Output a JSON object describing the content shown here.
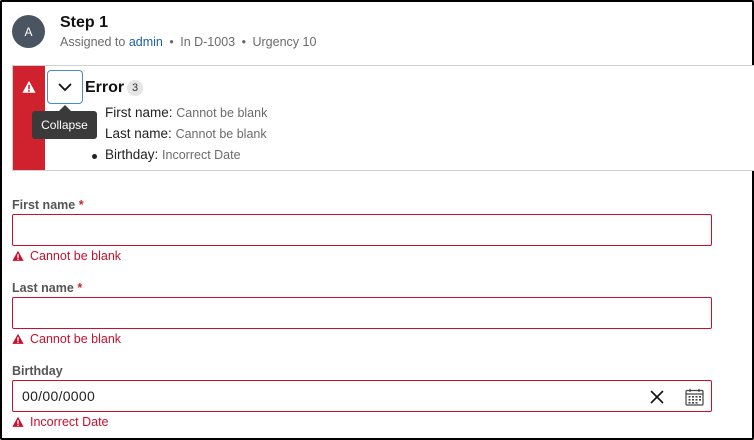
{
  "header": {
    "avatar_initial": "A",
    "title": "Step 1",
    "assigned_prefix": "Assigned to",
    "assignee": "admin",
    "case_id": "In D-1003",
    "urgency": "Urgency 10"
  },
  "error_banner": {
    "title": "Error",
    "count": "3",
    "collapse_tooltip": "Collapse",
    "items": [
      {
        "field": "First name:",
        "message": "Cannot be blank"
      },
      {
        "field": "Last name:",
        "message": "Cannot be blank"
      },
      {
        "field": "Birthday:",
        "message": "Incorrect Date"
      }
    ]
  },
  "form": {
    "first_name": {
      "label": "First name",
      "required_mark": "*",
      "value": "",
      "error": "Cannot be blank"
    },
    "last_name": {
      "label": "Last name",
      "required_mark": "*",
      "value": "",
      "error": "Cannot be blank"
    },
    "birthday": {
      "label": "Birthday",
      "value": "00/00/0000",
      "error": "Incorrect Date"
    }
  },
  "colors": {
    "error": "#c8102e",
    "banner_strip": "#d0222e",
    "link": "#1c5fa8",
    "avatar_bg": "#4a5561"
  },
  "icons": {
    "banner_warning": "warning-icon",
    "collapse": "chevron-down-icon",
    "clear": "close-icon",
    "calendar": "calendar-icon"
  }
}
